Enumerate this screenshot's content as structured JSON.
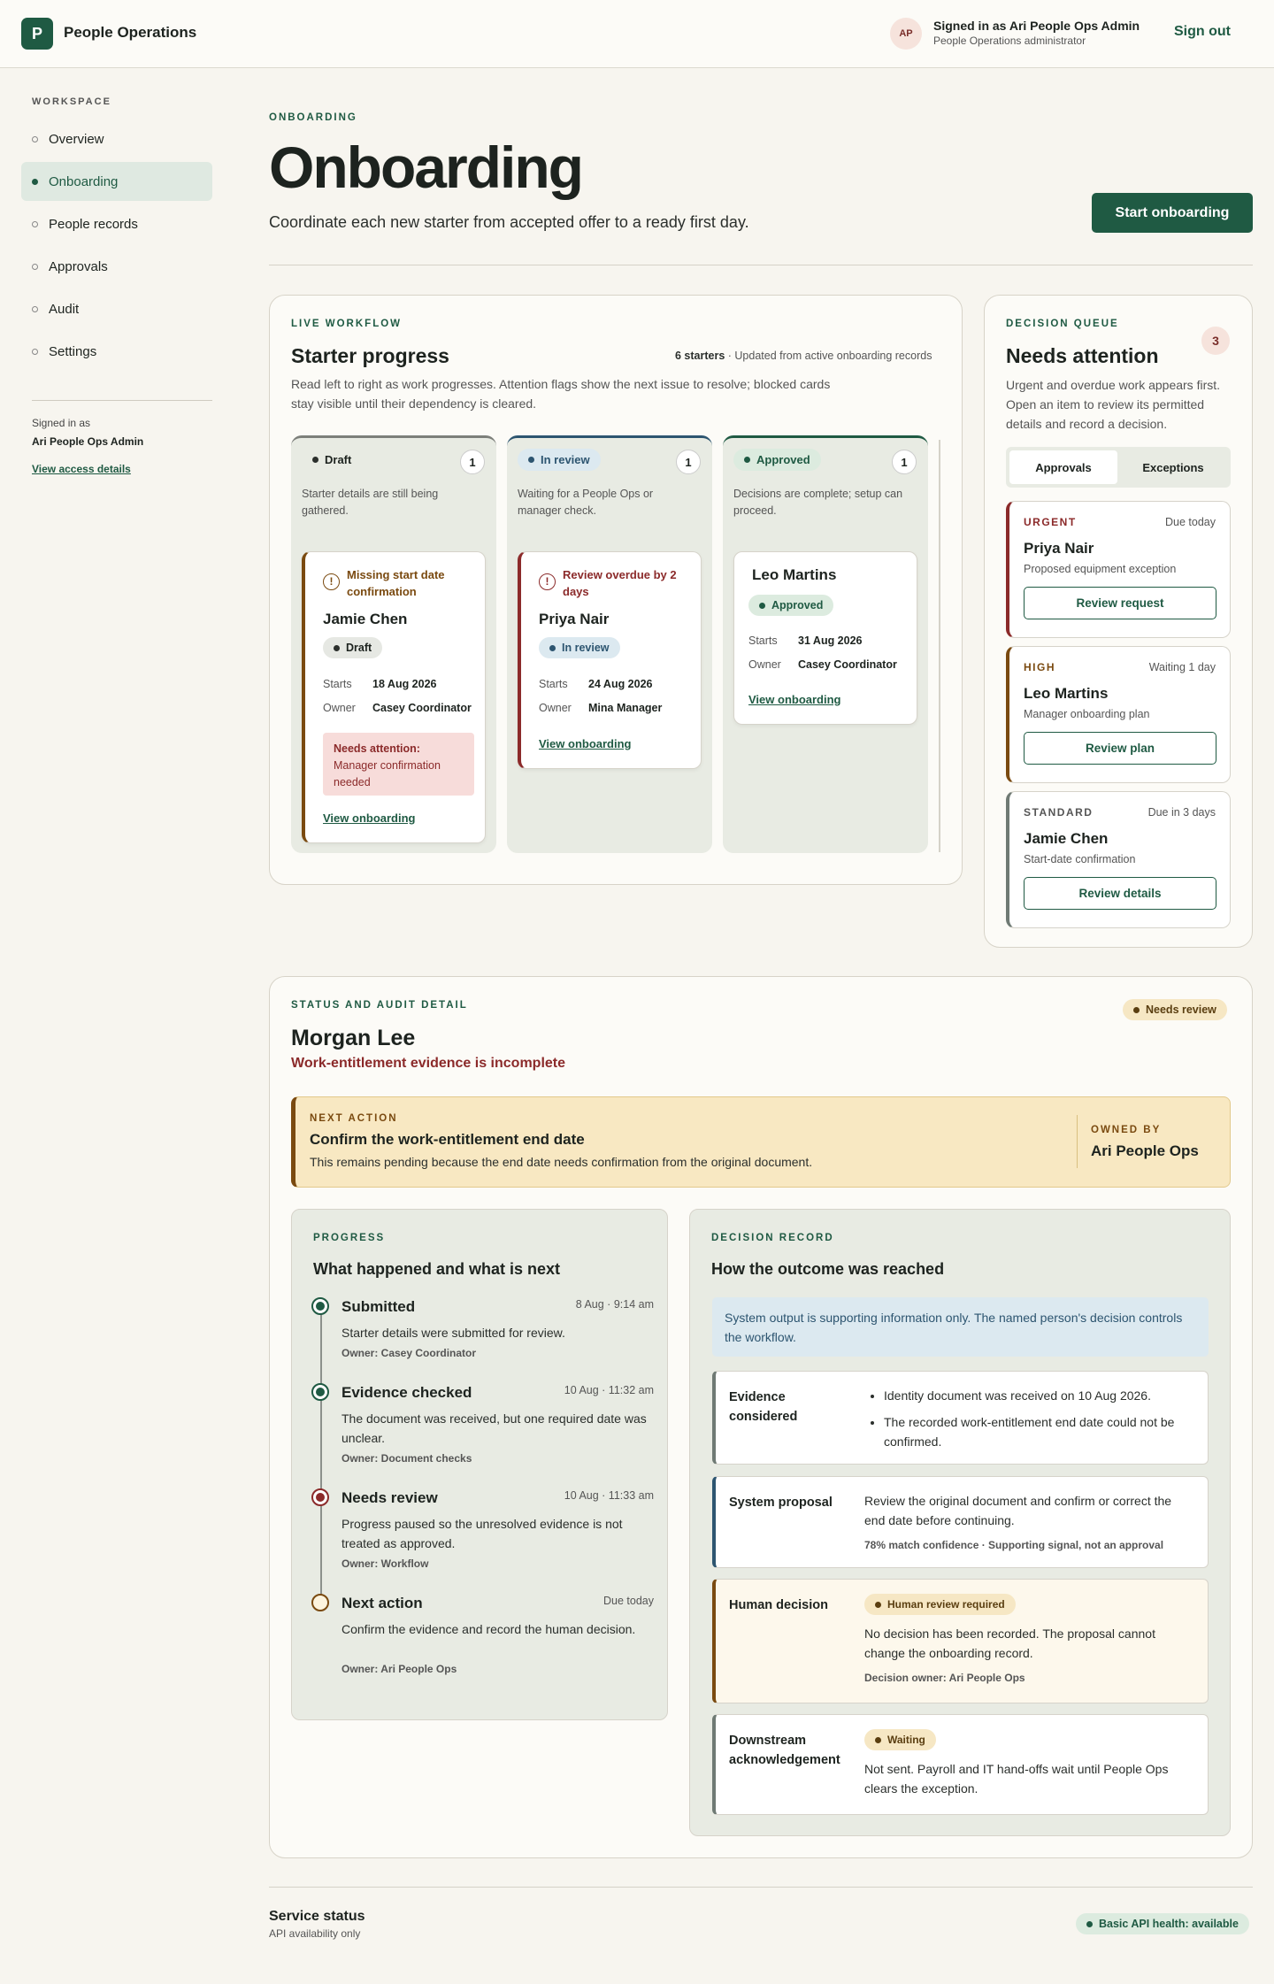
{
  "topbar": {
    "logo_letter": "P",
    "app_name": "People Operations",
    "avatar": "AP",
    "signed_in": "Signed in as Ari People Ops Admin",
    "role": "People Operations administrator",
    "sign_out": "Sign out"
  },
  "sidebar": {
    "section": "WORKSPACE",
    "items": [
      {
        "label": "Overview"
      },
      {
        "label": "Onboarding"
      },
      {
        "label": "People records"
      },
      {
        "label": "Approvals"
      },
      {
        "label": "Audit"
      },
      {
        "label": "Settings"
      }
    ],
    "signed_label": "Signed in as",
    "signed_name": "Ari People Ops Admin",
    "access_link": "View access details"
  },
  "header": {
    "eyebrow": "ONBOARDING",
    "title": "Onboarding",
    "subtitle": "Coordinate each new starter from accepted offer to a ready first day.",
    "start_button": "Start onboarding"
  },
  "workflow": {
    "eyebrow": "LIVE WORKFLOW",
    "title": "Starter progress",
    "meta_bold": "6 starters",
    "meta": " · Updated from active onboarding records",
    "desc1": "Read left to right as work progresses. Attention flags show the next issue to resolve; blocked cards",
    "desc2": "stay visible until their dependency is cleared.",
    "columns": [
      {
        "status": "Draft",
        "count": "1",
        "desc": "Starter details are still being gathered.",
        "card": {
          "flag": "Missing start date confirmation",
          "name": "Jamie Chen",
          "pill": "Draft",
          "starts_label": "Starts",
          "starts": "18 Aug 2026",
          "owner_label": "Owner",
          "owner": "Casey Coordinator",
          "attention_title": "Needs attention:",
          "attention_text": "Manager confirmation needed",
          "link": "View onboarding"
        }
      },
      {
        "status": "In review",
        "count": "1",
        "desc": "Waiting for a People Ops or manager check.",
        "card": {
          "flag": "Review overdue by 2 days",
          "name": "Priya Nair",
          "pill": "In review",
          "starts_label": "Starts",
          "starts": "24 Aug 2026",
          "owner_label": "Owner",
          "owner": "Mina Manager",
          "link": "View onboarding"
        }
      },
      {
        "status": "Approved",
        "count": "1",
        "desc": "Decisions are complete; setup can proceed.",
        "card": {
          "name": "Leo Martins",
          "pill": "Approved",
          "starts_label": "Starts",
          "starts": "31 Aug 2026",
          "owner_label": "Owner",
          "owner": "Casey Coordinator",
          "link": "View onboarding"
        }
      }
    ]
  },
  "queue": {
    "eyebrow": "DECISION QUEUE",
    "title": "Needs attention",
    "count": "3",
    "desc": "Urgent and overdue work appears first. Open an item to review its permitted details and record a decision.",
    "tabs": [
      "Approvals",
      "Exceptions"
    ],
    "items": [
      {
        "tag": "URGENT",
        "due": "Due today",
        "name": "Priya Nair",
        "desc": "Proposed equipment exception",
        "button": "Review request",
        "color": "#8b2a2a"
      },
      {
        "tag": "HIGH",
        "due": "Waiting 1 day",
        "name": "Leo Martins",
        "desc": "Manager onboarding plan",
        "button": "Review plan",
        "color": "#7a4a10"
      },
      {
        "tag": "STANDARD",
        "due": "Due in 3 days",
        "name": "Jamie Chen",
        "desc": "Start-date confirmation",
        "button": "Review details",
        "color": "#6f7a74"
      }
    ]
  },
  "detail": {
    "eyebrow": "STATUS AND AUDIT DETAIL",
    "name": "Morgan Lee",
    "issue": "Work-entitlement evidence is incomplete",
    "badge": "Needs review",
    "next": {
      "eyebrow": "NEXT ACTION",
      "title": "Confirm the work-entitlement end date",
      "text": "This remains pending because the end date needs confirmation from the original document.",
      "owned_label": "OWNED BY",
      "owner": "Ari People Ops"
    },
    "progress": {
      "eyebrow": "PROGRESS",
      "title": "What happened and what is next",
      "items": [
        {
          "title": "Submitted",
          "time": "8 Aug · 9:14 am",
          "desc": "Starter details were submitted for review.",
          "owner": "Owner: Casey Coordinator"
        },
        {
          "title": "Evidence checked",
          "time": "10 Aug · 11:32 am",
          "desc": "The document was received, but one required date was unclear.",
          "owner": "Owner: Document checks"
        },
        {
          "title": "Needs review",
          "time": "10 Aug · 11:33 am",
          "desc": "Progress paused so the unresolved evidence is not treated as approved.",
          "owner": "Owner: Workflow"
        },
        {
          "title": "Next action",
          "time": "Due today",
          "desc": "Confirm the evidence and record the human decision.",
          "owner": "Owner: Ari People Ops"
        }
      ]
    },
    "record": {
      "eyebrow": "DECISION RECORD",
      "title": "How the outcome was reached",
      "notice": "System output is supporting information only. The named person's decision controls the workflow.",
      "evidence_label": "Evidence considered",
      "evidence": [
        "Identity document was received on 10 Aug 2026.",
        "The recorded work-entitlement end date could not be confirmed."
      ],
      "proposal_label": "System proposal",
      "proposal": "Review the original document and confirm or correct the end date before continuing.",
      "proposal_meta": "78% match confidence · Supporting signal, not an approval",
      "human_label": "Human decision",
      "human_pill": "Human review required",
      "human_text": "No decision has been recorded. The proposal cannot change the onboarding record.",
      "human_meta": "Decision owner: Ari People Ops",
      "down_label": "Downstream acknowledgement",
      "down_pill": "Waiting",
      "down_text": "Not sent. Payroll and IT hand-offs wait until People Ops clears the exception."
    }
  },
  "footer": {
    "title": "Service status",
    "sub": "API availability only",
    "health": "Basic API health: available"
  },
  "colors": {
    "accent": "#1f5a43",
    "urgent": "#8b2a2a",
    "warning": "#7a4a10"
  }
}
